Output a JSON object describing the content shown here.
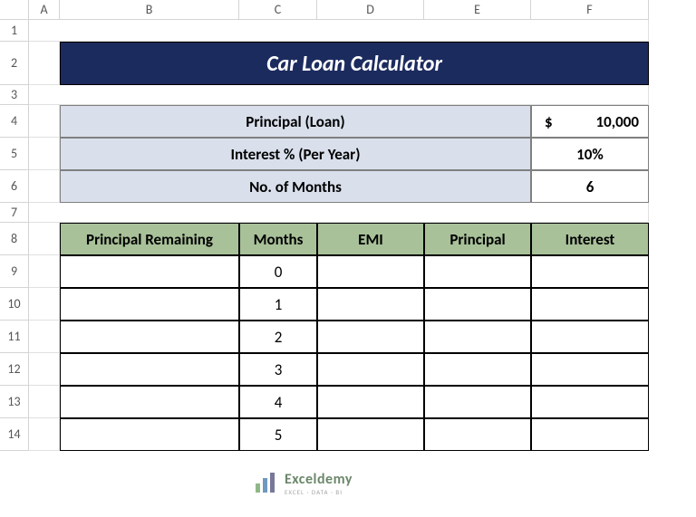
{
  "columns": [
    "A",
    "B",
    "C",
    "D",
    "E",
    "F"
  ],
  "rows": [
    "1",
    "2",
    "3",
    "4",
    "5",
    "6",
    "7",
    "8",
    "9",
    "10",
    "11",
    "12",
    "13",
    "14"
  ],
  "title": "Car Loan Calculator",
  "inputs": {
    "principal_label": "Principal (Loan)",
    "principal_currency": "$",
    "principal_value": "10,000",
    "interest_label": "Interest % (Per Year)",
    "interest_value": "10%",
    "months_label": "No. of Months",
    "months_value": "6"
  },
  "table_headers": {
    "principal_remaining": "Principal Remaining",
    "months": "Months",
    "emi": "EMI",
    "principal": "Principal",
    "interest": "Interest"
  },
  "table_rows": [
    {
      "principal_remaining": "",
      "months": "0",
      "emi": "",
      "principal": "",
      "interest": ""
    },
    {
      "principal_remaining": "",
      "months": "1",
      "emi": "",
      "principal": "",
      "interest": ""
    },
    {
      "principal_remaining": "",
      "months": "2",
      "emi": "",
      "principal": "",
      "interest": ""
    },
    {
      "principal_remaining": "",
      "months": "3",
      "emi": "",
      "principal": "",
      "interest": ""
    },
    {
      "principal_remaining": "",
      "months": "4",
      "emi": "",
      "principal": "",
      "interest": ""
    },
    {
      "principal_remaining": "",
      "months": "5",
      "emi": "",
      "principal": "",
      "interest": ""
    }
  ],
  "watermark": {
    "brand": "Exceldemy",
    "tagline": "EXCEL · DATA · BI"
  }
}
